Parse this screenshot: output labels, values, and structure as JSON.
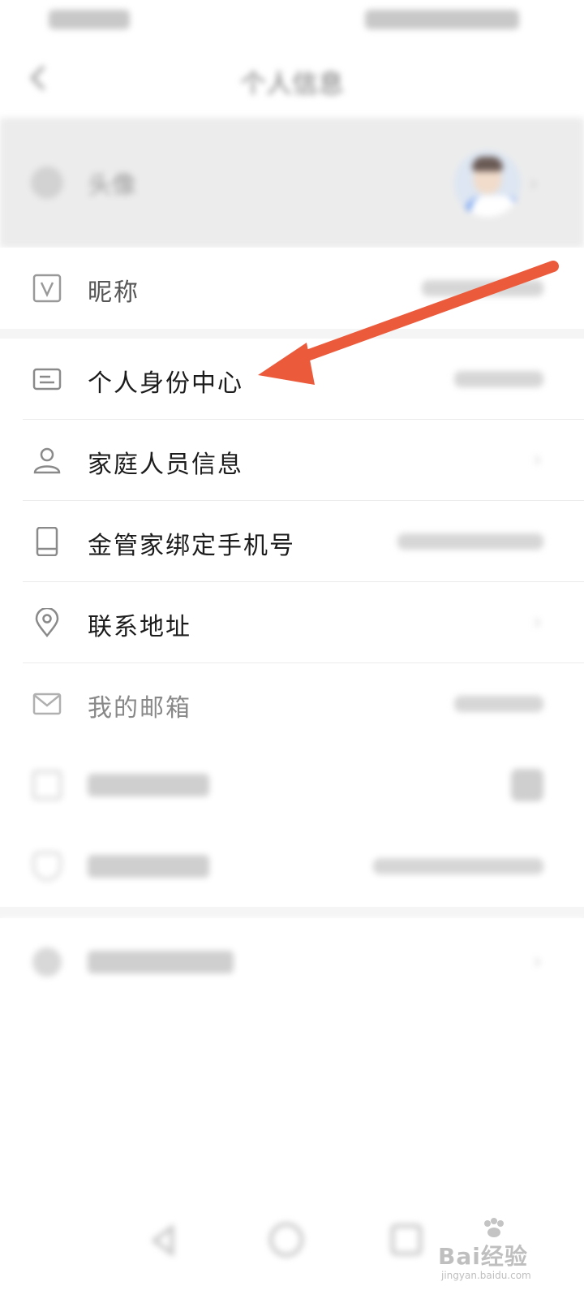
{
  "colors": {
    "accent_arrow": "#ec5a3c",
    "row_bg": "#ffffff",
    "band_bg": "#f5f5f5",
    "avatar_band": "#ececec"
  },
  "header": {
    "title": "个人信息",
    "back_icon": "chevron-left-icon"
  },
  "avatar_row": {
    "label": "头像"
  },
  "rows": [
    {
      "label": "昵称",
      "icon": "v-badge-icon"
    },
    {
      "label": "个人身份中心",
      "icon": "id-card-icon"
    },
    {
      "label": "家庭人员信息",
      "icon": "person-icon"
    },
    {
      "label": "金管家绑定手机号",
      "icon": "phone-icon"
    },
    {
      "label": "联系地址",
      "icon": "location-pin-icon"
    },
    {
      "label": "我的邮箱",
      "icon": "mail-icon"
    }
  ],
  "watermark": {
    "main": "Bai经验",
    "sub": "jingyan.baidu.com"
  }
}
